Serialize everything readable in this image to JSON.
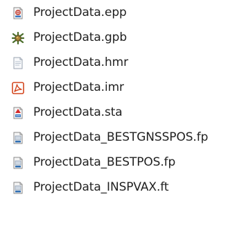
{
  "files": [
    {
      "name": "ProjectData.epp",
      "icon": "epp-file-icon"
    },
    {
      "name": "ProjectData.gpb",
      "icon": "gpb-file-icon"
    },
    {
      "name": "ProjectData.hmr",
      "icon": "hmr-file-icon"
    },
    {
      "name": "ProjectData.imr",
      "icon": "imr-file-icon"
    },
    {
      "name": "ProjectData.sta",
      "icon": "sta-file-icon"
    },
    {
      "name": "ProjectData_BESTGNSSPOS.fp",
      "icon": "fp-file-icon"
    },
    {
      "name": "ProjectData_BESTPOS.fp",
      "icon": "fp-file-icon"
    },
    {
      "name": "ProjectData_INSPVAX.ft",
      "icon": "ft-file-icon"
    }
  ]
}
